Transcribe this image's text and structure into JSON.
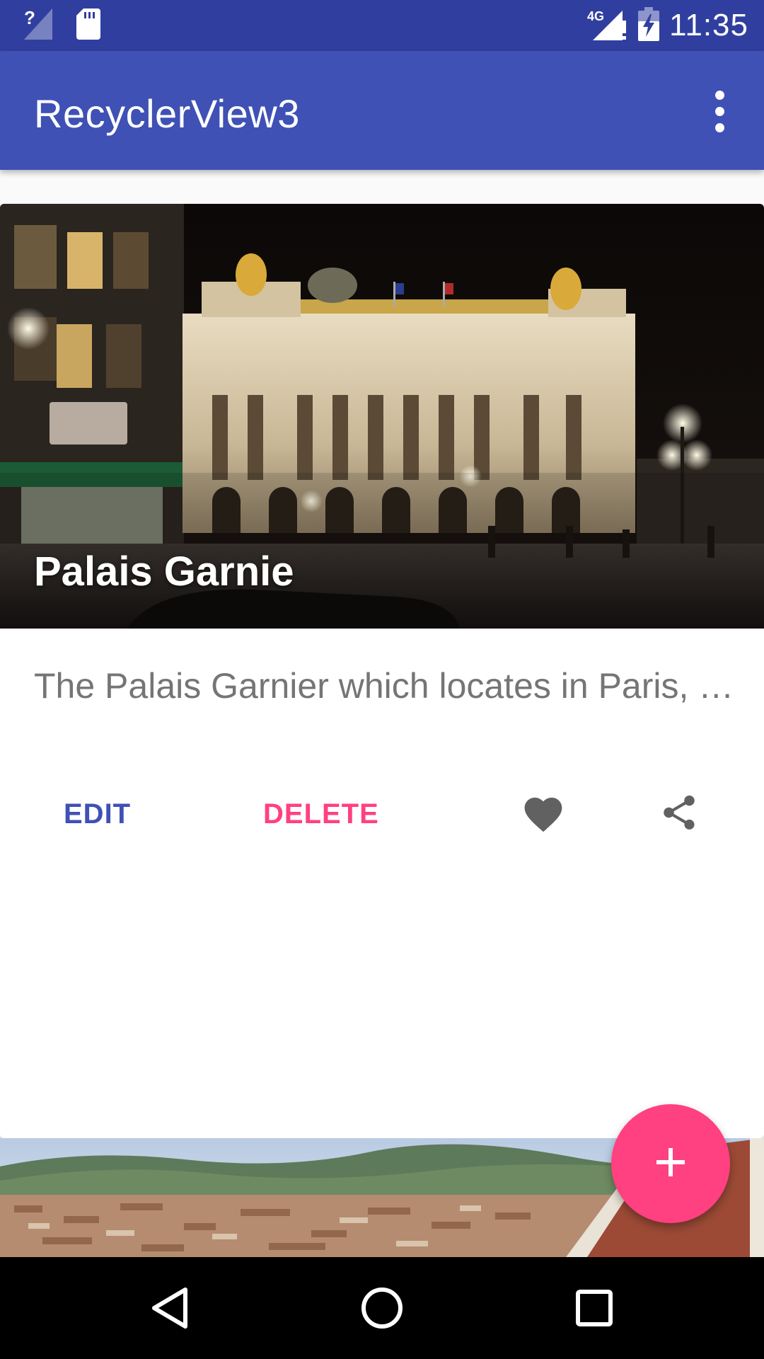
{
  "status_bar": {
    "time": "11:35",
    "network_label": "4G",
    "icons": [
      "signal-unknown-icon",
      "sd-card-icon",
      "signal-4g-icon",
      "battery-charging-icon"
    ]
  },
  "app_bar": {
    "title": "RecyclerView3",
    "overflow_icon": "more-vert-icon"
  },
  "cards": [
    {
      "title": "Palais Garnie",
      "description": "The Palais Garnier which locates in Paris, France",
      "actions": {
        "edit_label": "EDIT",
        "delete_label": "DELETE",
        "favorite_icon": "heart-icon",
        "share_icon": "share-icon"
      }
    }
  ],
  "fab": {
    "icon": "add-icon"
  },
  "nav_bar": {
    "icons": [
      "back-icon",
      "home-icon",
      "recents-icon"
    ]
  },
  "colors": {
    "primary": "#3f51b5",
    "primary_dark": "#303f9f",
    "accent": "#ff4081",
    "description_text": "#757575",
    "icon_gray": "#616161"
  }
}
